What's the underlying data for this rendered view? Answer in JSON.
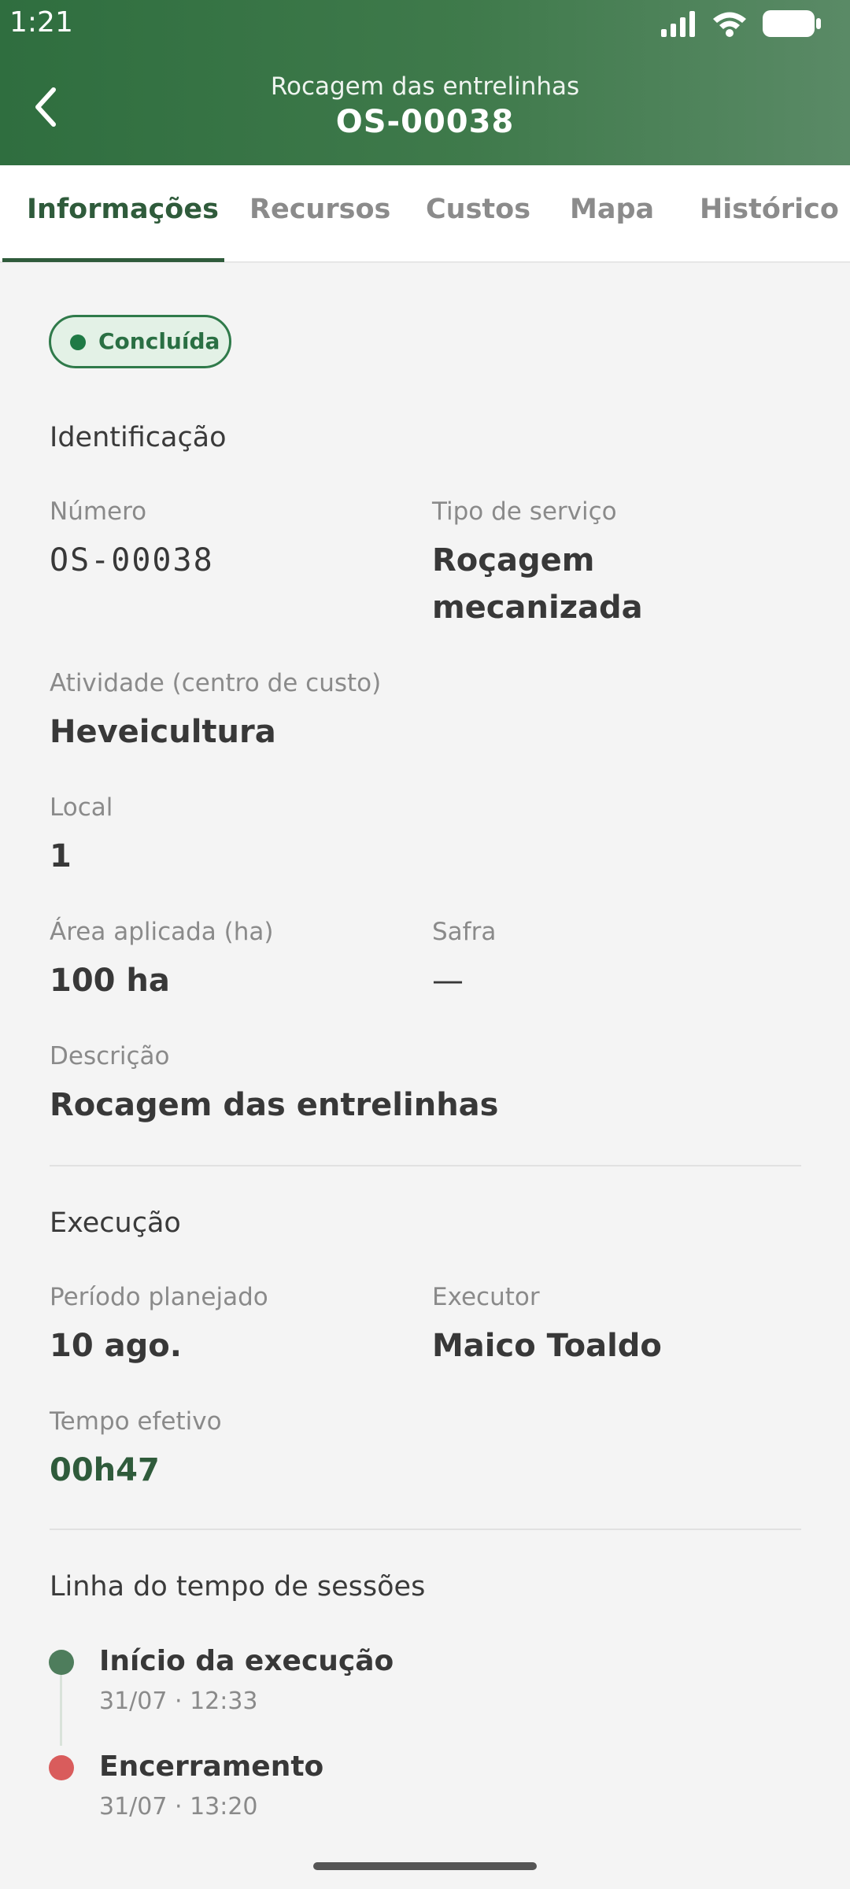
{
  "status_bar": {
    "time": "1:21"
  },
  "header": {
    "subtitle": "Rocagem das entrelinhas",
    "title": "OS-00038"
  },
  "tabs": [
    {
      "label": "Informações",
      "active": true
    },
    {
      "label": "Recursos",
      "active": false
    },
    {
      "label": "Custos",
      "active": false
    },
    {
      "label": "Mapa",
      "active": false
    },
    {
      "label": "Histórico",
      "active": false
    }
  ],
  "status_badge": {
    "label": "Concluída",
    "color": "#1f7a45"
  },
  "identificacao": {
    "title": "Identificação",
    "numero": {
      "label": "Número",
      "value": "OS-00038"
    },
    "tipo_servico": {
      "label": "Tipo de serviço",
      "value_line1": "Roçagem",
      "value_line2": "mecanizada"
    },
    "atividade": {
      "label": "Atividade (centro de custo)",
      "value": "Heveicultura"
    },
    "local": {
      "label": "Local",
      "value": "1"
    },
    "area": {
      "label": "Área aplicada (ha)",
      "value": "100 ha"
    },
    "safra": {
      "label": "Safra",
      "value": "—"
    },
    "descricao": {
      "label": "Descrição",
      "value": "Rocagem das entrelinhas"
    }
  },
  "execucao": {
    "title": "Execução",
    "periodo": {
      "label": "Período planejado",
      "value": "10 ago."
    },
    "executor": {
      "label": "Executor",
      "value": "Maico Toaldo"
    },
    "tempo": {
      "label": "Tempo efetivo",
      "value": "00h47"
    }
  },
  "timeline": {
    "title": "Linha do tempo de sessões",
    "events": [
      {
        "title": "Início da execução",
        "time": "31/07 · 12:33",
        "color": "#4e7d5c"
      },
      {
        "title": "Encerramento",
        "time": "31/07 · 13:20",
        "color": "#d95c5c"
      }
    ]
  }
}
